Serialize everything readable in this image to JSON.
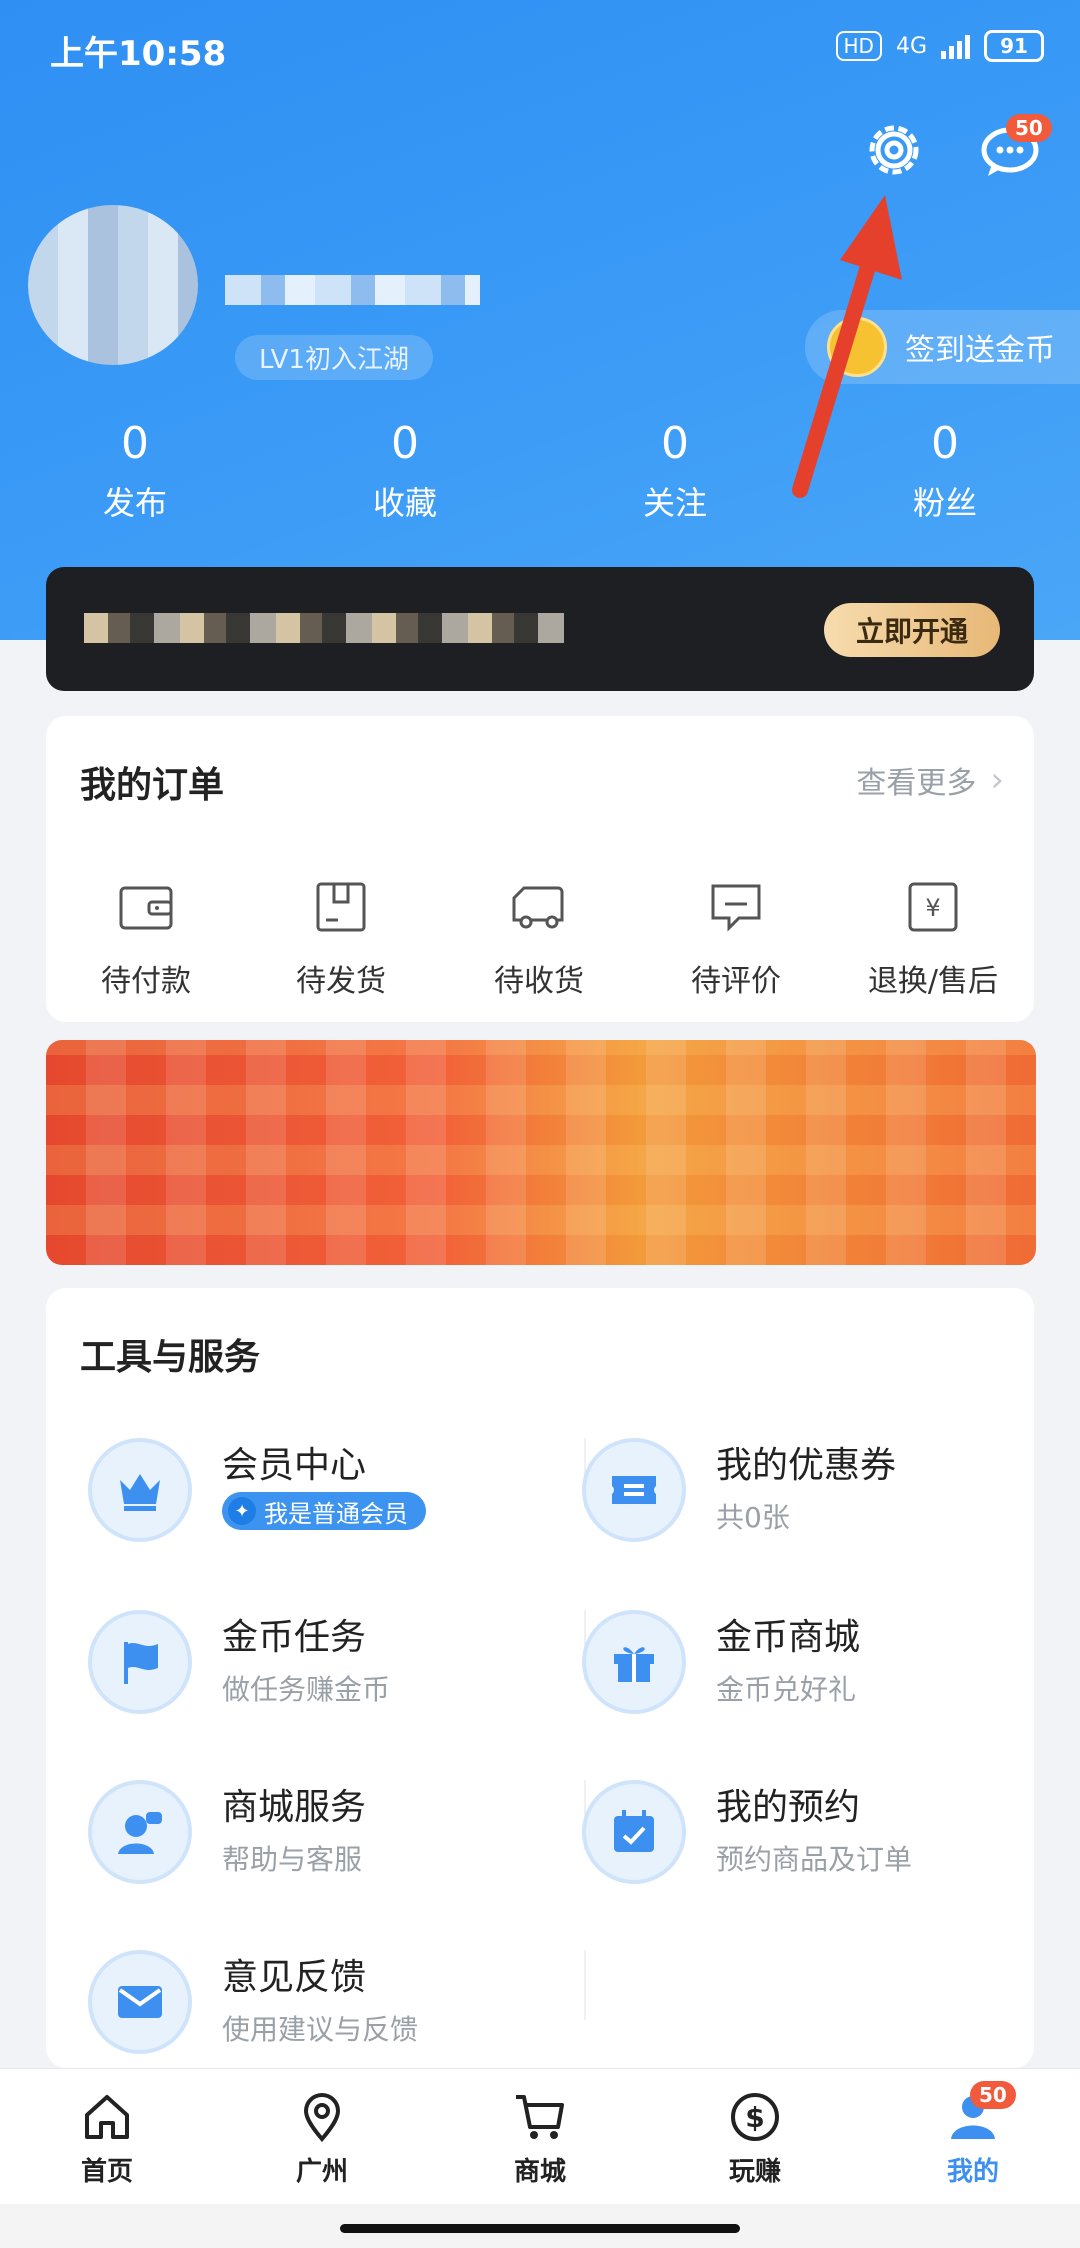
{
  "status": {
    "time": "上午10:58",
    "hd": "HD",
    "net": "4G",
    "battery": "91"
  },
  "header": {
    "message_badge": "50",
    "level": "LV1初入江湖",
    "checkin": "签到送金币"
  },
  "stats": [
    {
      "value": "0",
      "label": "发布"
    },
    {
      "value": "0",
      "label": "收藏"
    },
    {
      "value": "0",
      "label": "关注"
    },
    {
      "value": "0",
      "label": "粉丝"
    }
  ],
  "vip": {
    "button": "立即开通"
  },
  "orders": {
    "title": "我的订单",
    "more": "查看更多",
    "items": [
      "待付款",
      "待发货",
      "待收货",
      "待评价",
      "退换/售后"
    ]
  },
  "tools": {
    "title": "工具与服务",
    "items": [
      {
        "title": "会员中心",
        "tag": "我是普通会员",
        "icon": "crown-icon"
      },
      {
        "title": "我的优惠券",
        "sub": "共0张",
        "icon": "ticket-icon"
      },
      {
        "title": "金币任务",
        "sub": "做任务赚金币",
        "icon": "flag-icon"
      },
      {
        "title": "金币商城",
        "sub": "金币兑好礼",
        "icon": "gift-icon"
      },
      {
        "title": "商城服务",
        "sub": "帮助与客服",
        "icon": "support-icon"
      },
      {
        "title": "我的预约",
        "sub": "预约商品及订单",
        "icon": "calendar-icon"
      },
      {
        "title": "意见反馈",
        "sub": "使用建议与反馈",
        "icon": "mail-icon"
      }
    ]
  },
  "nav": {
    "items": [
      "首页",
      "广州",
      "商城",
      "玩赚",
      "我的"
    ],
    "badge": "50"
  },
  "colors": {
    "primary": "#3b9bf6",
    "accent": "#f15a3b"
  }
}
